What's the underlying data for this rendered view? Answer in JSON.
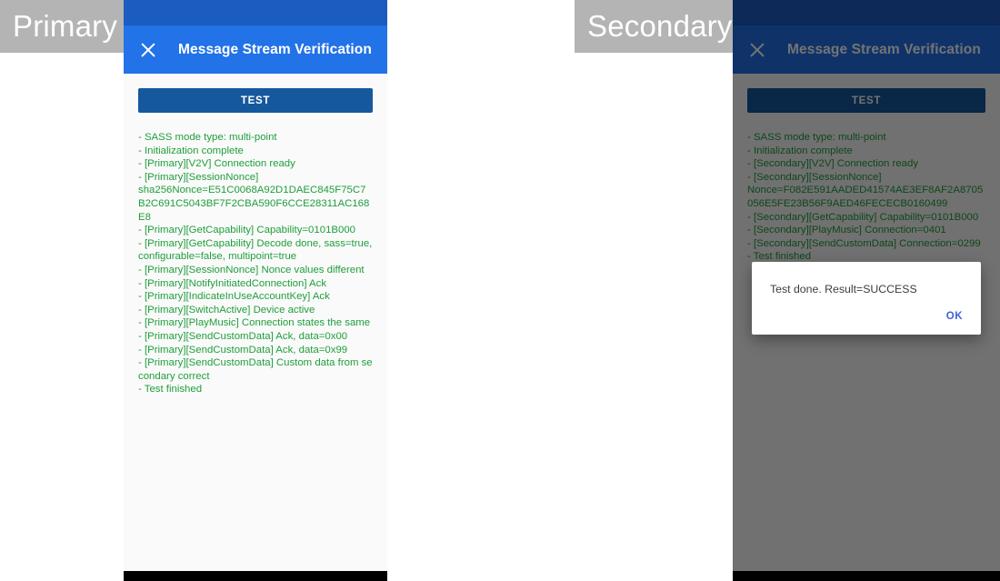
{
  "captions": {
    "primary": "Primary",
    "secondary": "Secondary"
  },
  "colors": {
    "status_bar": "#1b5cc0",
    "app_bar": "#2272e8",
    "test_button": "#16589e",
    "log_text": "#1f9e3c",
    "dialog_action": "#3f62d0",
    "caption_chip": "#b4b4b4",
    "content_background": "#fafafa",
    "nav_bar": "#000000"
  },
  "primary": {
    "app_bar": {
      "close_icon": "close-icon",
      "title": "Message Stream Verification"
    },
    "test_button_label": "TEST",
    "log": "- SASS mode type: multi-point\n- Initialization complete\n- [Primary][V2V] Connection ready\n- [Primary][SessionNonce]\nsha256Nonce=E51C0068A92D1DAEC845F75C7B2C691C5043BF7F2CBA590F6CCE28311AC168E8\n- [Primary][GetCapability] Capability=0101B000\n- [Primary][GetCapability] Decode done, sass=true, configurable=false, multipoint=true\n- [Primary][SessionNonce] Nonce values different\n- [Primary][NotifyInitiatedConnection] Ack\n- [Primary][IndicateInUseAccountKey] Ack\n- [Primary][SwitchActive] Device active\n- [Primary][PlayMusic] Connection states the same\n- [Primary][SendCustomData] Ack, data=0x00\n- [Primary][SendCustomData] Ack, data=0x99\n- [Primary][SendCustomData] Custom data from secondary correct\n- Test finished"
  },
  "secondary": {
    "app_bar": {
      "close_icon": "close-icon",
      "title": "Message Stream Verification"
    },
    "test_button_label": "TEST",
    "log": "- SASS mode type: multi-point\n- Initialization complete\n- [Secondary][V2V] Connection ready\n- [Secondary][SessionNonce]\nNonce=F082E591AADED41574AE3EF8AF2A8705056E5FE23B56F9AED46FECECB0160499\n- [Secondary][GetCapability] Capability=0101B000\n- [Secondary][PlayMusic] Connection=0401\n- [Secondary][SendCustomData] Connection=0299\n- Test finished",
    "dialog": {
      "message": "Test done. Result=SUCCESS",
      "ok_label": "OK"
    }
  }
}
